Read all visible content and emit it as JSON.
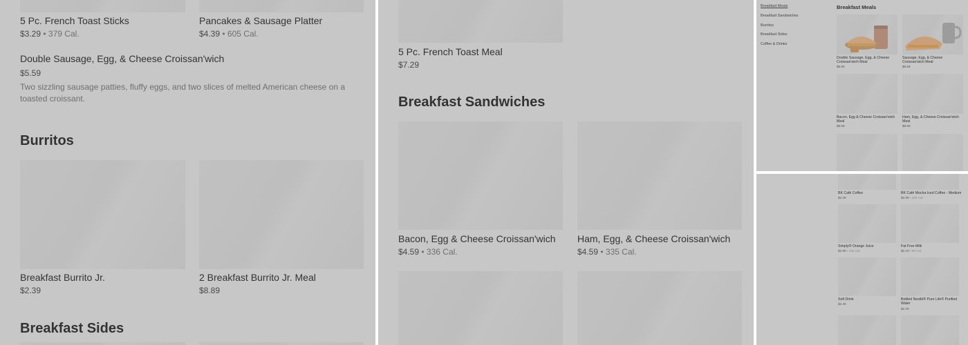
{
  "panel_a": {
    "items_top": [
      {
        "name": "5 Pc. French Toast Sticks",
        "price": "$3.29",
        "sep": "•",
        "calories": "379 Cal."
      },
      {
        "name": "Pancakes & Sausage Platter",
        "price": "$4.39",
        "sep": "•",
        "calories": "605 Cal."
      }
    ],
    "featured": {
      "name": "Double Sausage, Egg, & Cheese Croissan'wich",
      "price": "$5.59",
      "description": "Two sizzling sausage patties, fluffy eggs, and two slices of melted American cheese on a toasted croissant."
    },
    "section_burritos": "Burritos",
    "burritos": [
      {
        "name": "Breakfast Burrito Jr.",
        "price": "$2.39"
      },
      {
        "name": "2 Breakfast Burrito Jr. Meal",
        "price": "$8.89"
      }
    ],
    "section_sides": "Breakfast Sides"
  },
  "panel_b": {
    "meal": {
      "name": "5 Pc. French Toast Meal",
      "price": "$7.29"
    },
    "section_sandwiches": "Breakfast Sandwiches",
    "sandwiches": [
      {
        "name": "Bacon, Egg & Cheese Croissan'wich",
        "price": "$4.59",
        "sep": "•",
        "calories": "336 Cal."
      },
      {
        "name": "Ham, Egg, & Cheese Croissan'wich",
        "price": "$4.59",
        "sep": "•",
        "calories": "335 Cal."
      }
    ]
  },
  "panel_c": {
    "nav": [
      "Breakfast Meals",
      "Breakfast Sandwiches",
      "Burritos",
      "Breakfast Sides",
      "Coffee & Drinks"
    ],
    "section_title": "Breakfast Meals",
    "items": [
      {
        "name": "Double Sausage, Egg, & Cheese Croissan'wich Meal",
        "price": "$8.89"
      },
      {
        "name": "Sausage, Egg, & Cheese Croissan'wich Meal",
        "price": "$8.59"
      },
      {
        "name": "Bacon, Egg & Cheese Croissan'wich Meal",
        "price": "$8.59"
      },
      {
        "name": "Ham, Egg, & Cheese Croissan'wich Meal",
        "price": "$8.59"
      }
    ]
  },
  "panel_d": {
    "items": [
      {
        "name": "BK Café Coffee",
        "price": "$2.29",
        "sep": "",
        "calories": ""
      },
      {
        "name": "BK Café Mocha Iced Coffee - Medium",
        "price": "$2.99",
        "sep": "•",
        "calories": "290 Cal."
      },
      {
        "name": "Simply® Orange Juice",
        "price": "$2.99",
        "sep": "•",
        "calories": "150 Cal."
      },
      {
        "name": "Fat Free Milk",
        "price": "$2.19",
        "sep": "•",
        "calories": "90 Cal."
      },
      {
        "name": "Soft Drink",
        "price": "$2.49",
        "sep": "",
        "calories": ""
      },
      {
        "name": "Bottled Nestlé® Pure Life® Purified Water",
        "price": "$2.29",
        "sep": "",
        "calories": ""
      }
    ]
  }
}
